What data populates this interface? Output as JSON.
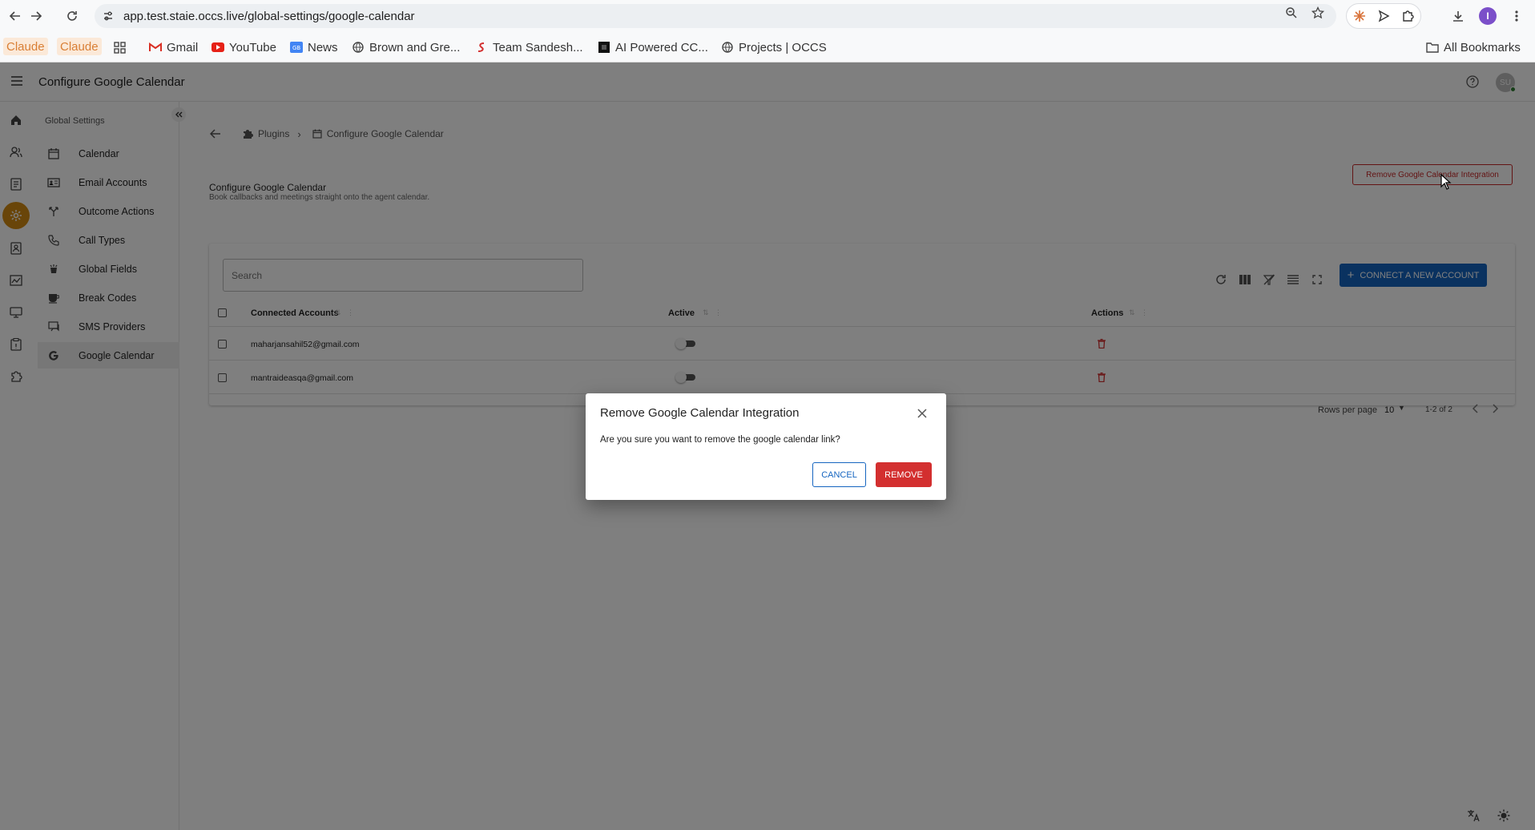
{
  "browser": {
    "url": "app.test.staie.occs.live/global-settings/google-calendar",
    "profile_initial": "I",
    "bookmarks": [
      {
        "label": "Claude",
        "type": "claude"
      },
      {
        "label": "Claude",
        "type": "claude"
      },
      {
        "label": "Gmail",
        "icon": "gmail-icon"
      },
      {
        "label": "YouTube",
        "icon": "youtube-icon"
      },
      {
        "label": "News",
        "icon": "news-icon"
      },
      {
        "label": "Brown and Gre...",
        "icon": "globe-icon"
      },
      {
        "label": "Team Sandesh...",
        "icon": "sandesh-icon"
      },
      {
        "label": "AI Powered CC...",
        "icon": "ai-icon"
      },
      {
        "label": "Projects | OCCS",
        "icon": "globe-icon"
      }
    ],
    "all_bookmarks_label": "All Bookmarks"
  },
  "app": {
    "title": "Configure Google Calendar",
    "avatar_initials": "SU"
  },
  "subnav": {
    "heading": "Global Settings",
    "items": [
      {
        "label": "Calendar",
        "icon": "calendar-icon"
      },
      {
        "label": "Email Accounts",
        "icon": "email-accounts-icon"
      },
      {
        "label": "Outcome Actions",
        "icon": "outcome-actions-icon"
      },
      {
        "label": "Call Types",
        "icon": "phone-icon"
      },
      {
        "label": "Global Fields",
        "icon": "global-fields-icon"
      },
      {
        "label": "Break Codes",
        "icon": "coffee-icon"
      },
      {
        "label": "SMS Providers",
        "icon": "sms-icon"
      },
      {
        "label": "Google Calendar",
        "icon": "google-icon",
        "active": true
      }
    ]
  },
  "breadcrumb": {
    "plugins": "Plugins",
    "separator": "›",
    "current": "Configure Google Calendar"
  },
  "page": {
    "title": "Configure Google Calendar",
    "subtitle": "Book callbacks and meetings straight onto the agent calendar.",
    "remove_integration_label": "Remove Google Calendar Integration"
  },
  "table": {
    "search_placeholder": "Search",
    "connect_label": "CONNECT A NEW ACCOUNT",
    "columns": {
      "accounts": "Connected Accounts",
      "active": "Active",
      "actions": "Actions"
    },
    "rows": [
      {
        "email": "maharjansahil52@gmail.com",
        "active": false
      },
      {
        "email": "mantraideasqa@gmail.com",
        "active": false
      }
    ],
    "rows_per_page_label": "Rows per page",
    "rows_per_page_value": "10",
    "range_label": "1-2 of 2"
  },
  "dialog": {
    "title": "Remove Google Calendar Integration",
    "message": "Are you sure you want to remove the google calendar link?",
    "cancel_label": "CANCEL",
    "remove_label": "REMOVE"
  },
  "colors": {
    "accent": "#d28a12",
    "primary": "#1565c0",
    "danger": "#d32f2f"
  }
}
